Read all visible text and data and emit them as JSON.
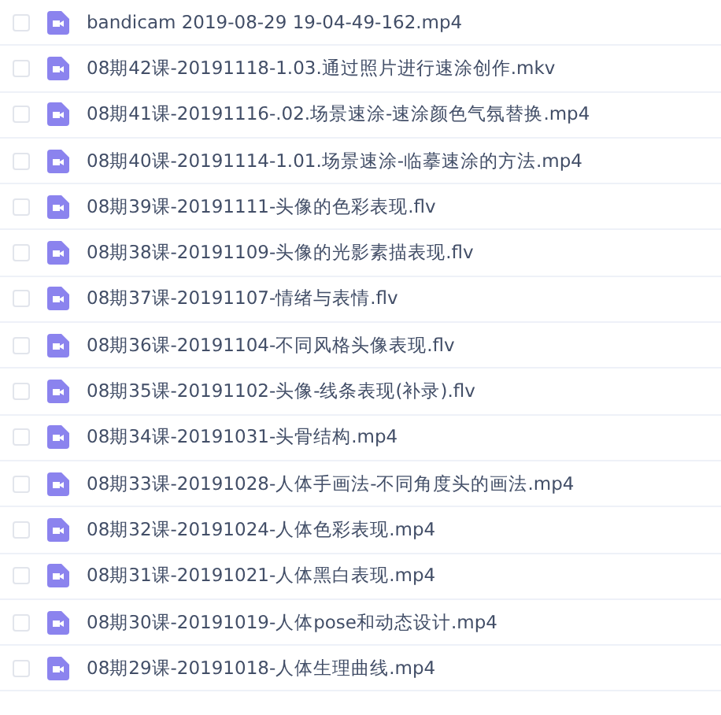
{
  "files": [
    {
      "name": "bandicam 2019-08-29 19-04-49-162.mp4",
      "checked": false
    },
    {
      "name": "08期42课-20191118-1.03.通过照片进行速涂创作.mkv",
      "checked": false
    },
    {
      "name": "08期41课-20191116-.02.场景速涂-速涂颜色气氛替换.mp4",
      "checked": false
    },
    {
      "name": "08期40课-20191114-1.01.场景速涂-临摹速涂的方法.mp4",
      "checked": false
    },
    {
      "name": "08期39课-20191111-头像的色彩表现.flv",
      "checked": false
    },
    {
      "name": "08期38课-20191109-头像的光影素描表现.flv",
      "checked": false
    },
    {
      "name": "08期37课-20191107-情绪与表情.flv",
      "checked": false
    },
    {
      "name": "08期36课-20191104-不同风格头像表现.flv",
      "checked": false
    },
    {
      "name": "08期35课-20191102-头像-线条表现(补录).flv",
      "checked": false
    },
    {
      "name": "08期34课-20191031-头骨结构.mp4",
      "checked": false
    },
    {
      "name": "08期33课-20191028-人体手画法-不同角度头的画法.mp4",
      "checked": false
    },
    {
      "name": "08期32课-20191024-人体色彩表现.mp4",
      "checked": false
    },
    {
      "name": "08期31课-20191021-人体黑白表现.mp4",
      "checked": false
    },
    {
      "name": "08期30课-20191019-人体pose和动态设计.mp4",
      "checked": false
    },
    {
      "name": "08期29课-20191018-人体生理曲线.mp4",
      "checked": false
    }
  ]
}
